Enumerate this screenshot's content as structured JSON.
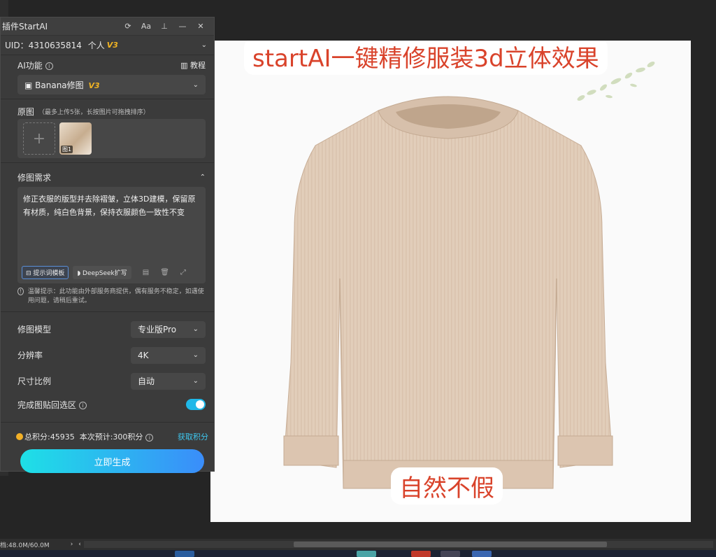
{
  "canvas": {
    "title": "startAI一键精修服装3d立体效果",
    "caption": "自然不假"
  },
  "panel": {
    "title": "插件StartAI",
    "titlebar_icons": [
      "refresh-icon",
      "font-size-icon",
      "pin-icon",
      "minimize-icon",
      "close-icon"
    ],
    "uid_label": "UID：4310635814",
    "account_type": "个人",
    "account_badge": "V3",
    "ai_function_label": "AI功能",
    "tutorial_label": "教程",
    "function_select": "Banana修图",
    "function_badge": "V3",
    "original_label": "原图",
    "original_hint": "（最多上传5张，长按图片可拖拽排序）",
    "thumb_label": "图1",
    "requirement_label": "修图需求",
    "requirement_text": "修正衣服的版型并去除褶皱，立体3D建模，保留原有材质，纯白色背景，保持衣服颜色一致性不变",
    "prompt_template_btn": "提示词模板",
    "deepseek_btn": "DeepSeek扩写",
    "notice": "温馨提示：此功能由外部服务商提供，偶有服务不稳定，如遇使用问题，请稍后重试。",
    "model_label": "修图模型",
    "model_value": "专业版Pro",
    "resolution_label": "分辨率",
    "resolution_value": "4K",
    "ratio_label": "尺寸比例",
    "ratio_value": "自动",
    "paste_back_label": "完成图贴回选区",
    "paste_back_on": true,
    "total_points": "总积分:45935",
    "estimate": "本次预计:300积分",
    "get_points": "获取积分",
    "generate_btn": "立即生成"
  },
  "status": {
    "doc_size": "档:48.0M/60.0M"
  },
  "colors": {
    "accent": "#1fb8e8",
    "badge": "#f0b323",
    "title_red": "#d9432b"
  }
}
